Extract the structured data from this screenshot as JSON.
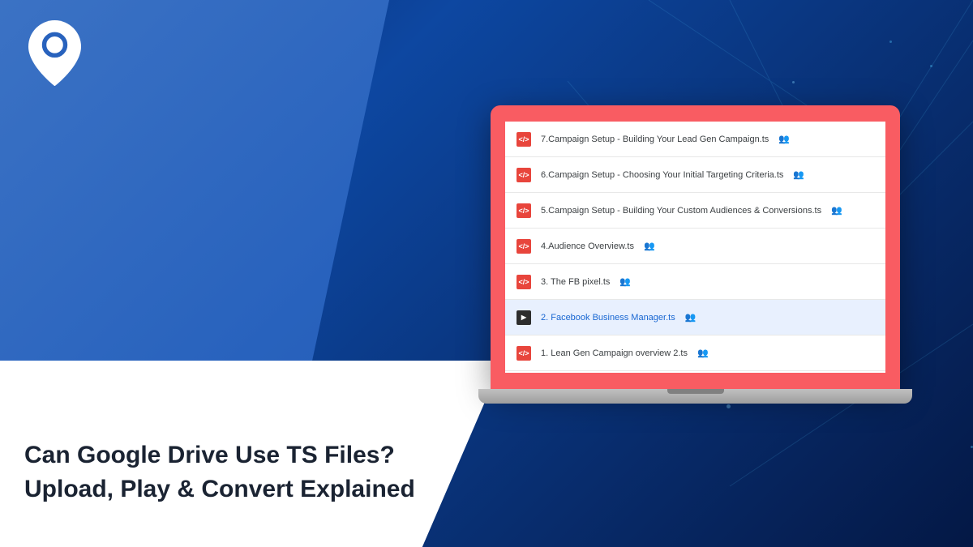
{
  "headline": {
    "line1": "Can Google Drive Use TS Files?",
    "line2": "Upload, Play & Convert Explained"
  },
  "files": [
    {
      "name": "7.Campaign Setup - Building Your Lead Gen Campaign.ts",
      "icon_type": "code",
      "shared": true,
      "selected": false
    },
    {
      "name": "6.Campaign Setup - Choosing Your Initial Targeting Criteria.ts",
      "icon_type": "code",
      "shared": true,
      "selected": false
    },
    {
      "name": "5.Campaign Setup - Building Your Custom Audiences & Conversions.ts",
      "icon_type": "code",
      "shared": true,
      "selected": false
    },
    {
      "name": "4.Audience Overview.ts",
      "icon_type": "code",
      "shared": true,
      "selected": false
    },
    {
      "name": "3. The FB pixel.ts",
      "icon_type": "code",
      "shared": true,
      "selected": false
    },
    {
      "name": "2. Facebook Business Manager.ts",
      "icon_type": "video",
      "shared": true,
      "selected": true
    },
    {
      "name": "1. Lean Gen Campaign overview 2.ts",
      "icon_type": "code",
      "shared": true,
      "selected": false
    }
  ],
  "icon_glyph": "</>"
}
